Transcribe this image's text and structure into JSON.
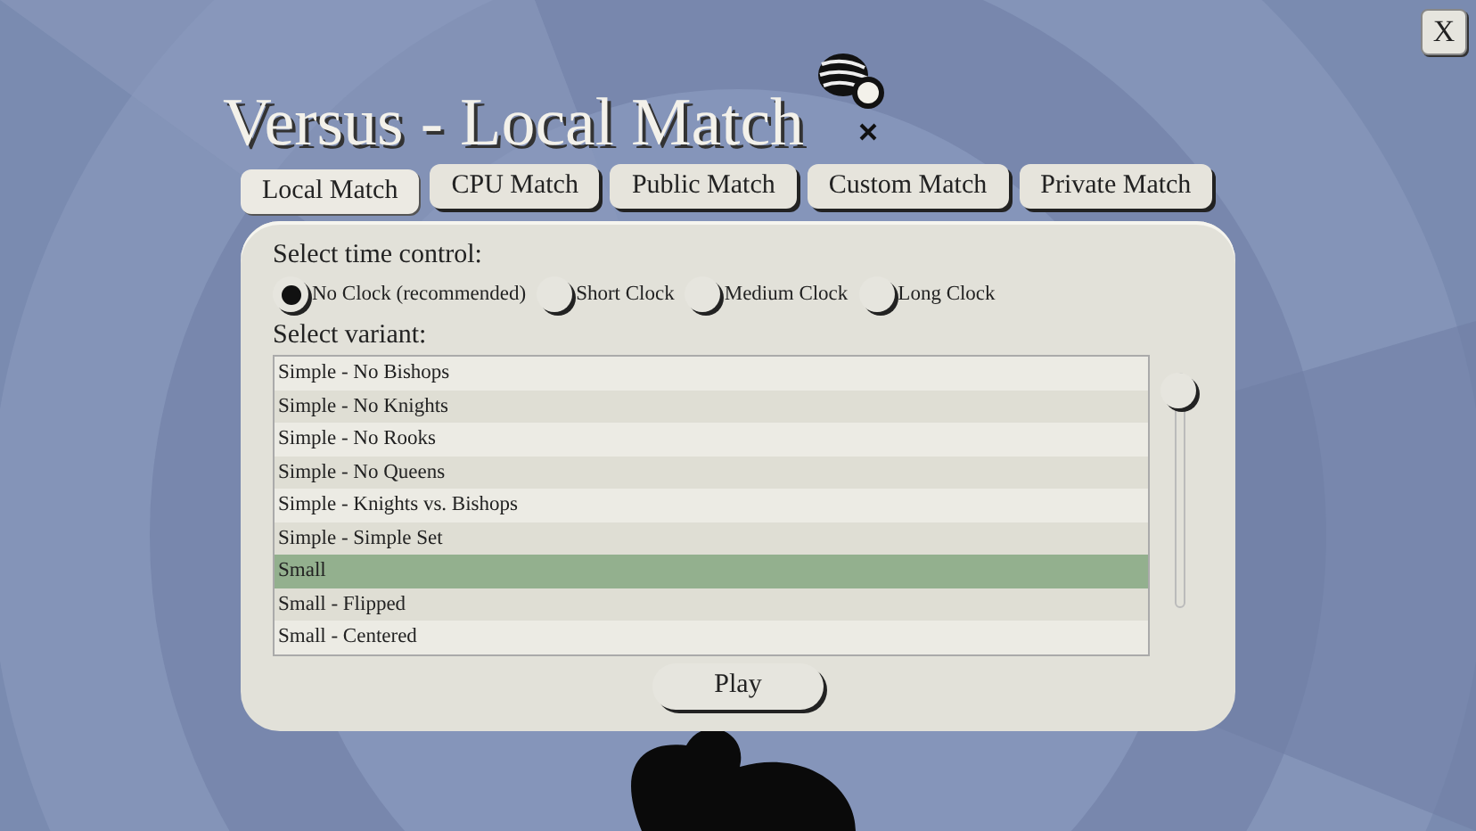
{
  "window": {
    "title": "Versus - Local Match",
    "close": "X"
  },
  "tabs": [
    {
      "label": "Local Match",
      "selected": true
    },
    {
      "label": "CPU Match",
      "selected": false
    },
    {
      "label": "Public Match",
      "selected": false
    },
    {
      "label": "Custom Match",
      "selected": false
    },
    {
      "label": "Private Match",
      "selected": false
    }
  ],
  "time_control": {
    "label": "Select time control:",
    "options": [
      {
        "label": "No Clock (recommended)",
        "selected": true
      },
      {
        "label": "Short Clock",
        "selected": false
      },
      {
        "label": "Medium Clock",
        "selected": false
      },
      {
        "label": "Long Clock",
        "selected": false
      }
    ]
  },
  "variants": {
    "label": "Select variant:",
    "items": [
      {
        "label": "Simple - No Bishops",
        "selected": false
      },
      {
        "label": "Simple - No Knights",
        "selected": false
      },
      {
        "label": "Simple - No Rooks",
        "selected": false
      },
      {
        "label": "Simple - No Queens",
        "selected": false
      },
      {
        "label": "Simple - Knights vs. Bishops",
        "selected": false
      },
      {
        "label": "Simple - Simple Set",
        "selected": false
      },
      {
        "label": "Small",
        "selected": true
      },
      {
        "label": "Small - Flipped",
        "selected": false
      },
      {
        "label": "Small - Centered",
        "selected": false
      }
    ]
  },
  "play_button": "Play"
}
